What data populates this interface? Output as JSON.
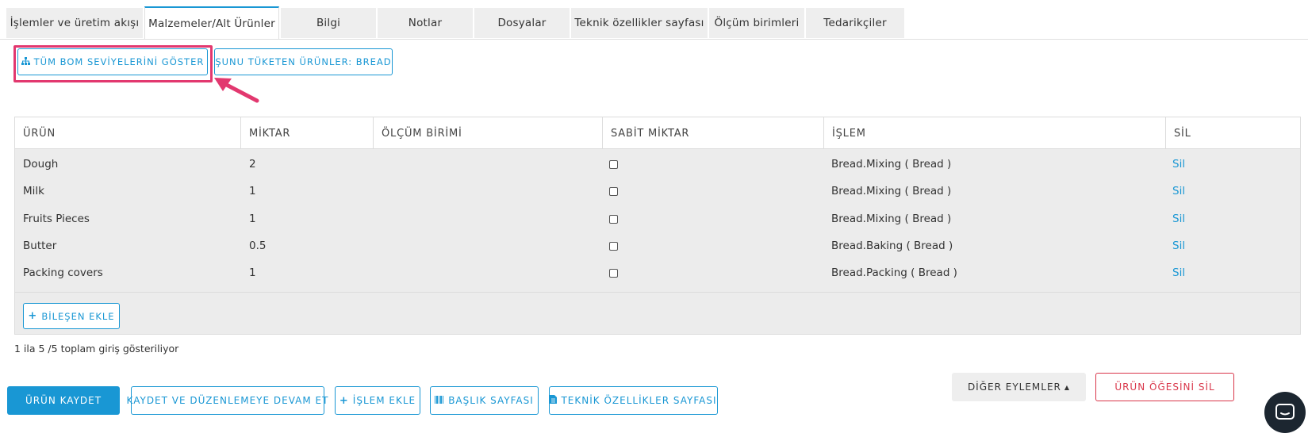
{
  "tabs": [
    {
      "label": "İşlemler ve üretim akışı",
      "active": false
    },
    {
      "label": "Malzemeler/Alt Ürünler",
      "active": true
    },
    {
      "label": "Bilgi",
      "active": false
    },
    {
      "label": "Notlar",
      "active": false
    },
    {
      "label": "Dosyalar",
      "active": false
    },
    {
      "label": "Teknik özellikler sayfası",
      "active": false
    },
    {
      "label": "Ölçüm birimleri",
      "active": false
    },
    {
      "label": "Tedarikçiler",
      "active": false
    }
  ],
  "toolbar": {
    "show_bom_label": "TÜM BOM SEVİYELERİNİ GÖSTER",
    "show_bom_icon": "sitemap-icon",
    "consumers_label": "ŞUNU TÜKETEN ÜRÜNLER: BREAD"
  },
  "table": {
    "columns": [
      "ÜRÜN",
      "MİKTAR",
      "ÖLÇÜM BİRİMİ",
      "SABİT MİKTAR",
      "İŞLEM",
      "SİL"
    ],
    "rows": [
      {
        "product": "Dough",
        "qty": "2",
        "unit": "",
        "fixed": false,
        "operation": "Bread.Mixing ( Bread )",
        "delete": "Sil"
      },
      {
        "product": "Milk",
        "qty": "1",
        "unit": "",
        "fixed": false,
        "operation": "Bread.Mixing ( Bread )",
        "delete": "Sil"
      },
      {
        "product": "Fruits Pieces",
        "qty": "1",
        "unit": "",
        "fixed": false,
        "operation": "Bread.Mixing ( Bread )",
        "delete": "Sil"
      },
      {
        "product": "Butter",
        "qty": "0.5",
        "unit": "",
        "fixed": false,
        "operation": "Bread.Baking ( Bread )",
        "delete": "Sil"
      },
      {
        "product": "Packing covers",
        "qty": "1",
        "unit": "",
        "fixed": false,
        "operation": "Bread.Packing ( Bread )",
        "delete": "Sil"
      }
    ],
    "add_component_label": "BİLEŞEN EKLE"
  },
  "info_text": "1 ila 5 /5 toplam giriş gösteriliyor",
  "actions": {
    "save": "ÜRÜN KAYDET",
    "save_continue": "KAYDET VE DÜZENLEMEYE DEVAM ET",
    "add_operation": "İŞLEM EKLE",
    "header_page": "BAŞLIK SAYFASI",
    "tech_specs_page": "TEKNİK ÖZELLİKLER SAYFASI",
    "other_actions": "DİĞER EYLEMLER",
    "delete_item": "ÜRÜN ÖĞESİNİ SİL"
  },
  "colors": {
    "accent": "#1997d4",
    "danger": "#d9364a",
    "highlight": "#e2386f"
  }
}
